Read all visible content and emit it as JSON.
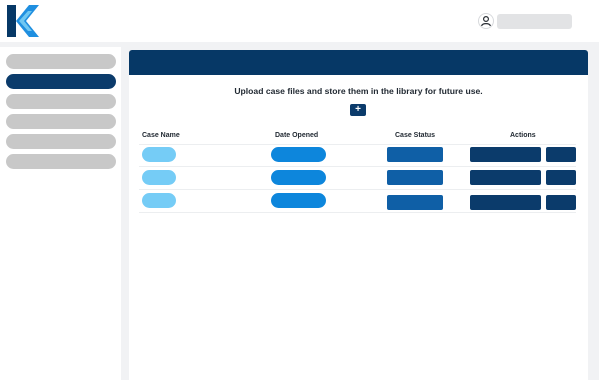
{
  "header": {
    "logo_icon": "kaseware-k-logo-icon",
    "user_icon": "user-icon",
    "user_name": ""
  },
  "sidebar": {
    "items": [
      {
        "label": "",
        "active": false
      },
      {
        "label": "",
        "active": true
      },
      {
        "label": "",
        "active": false
      },
      {
        "label": "",
        "active": false
      },
      {
        "label": "",
        "active": false
      },
      {
        "label": "",
        "active": false
      }
    ]
  },
  "main": {
    "instruction": "Upload case files and store them in the library for future use.",
    "add_button_label": "+",
    "table": {
      "columns": [
        "Case Name",
        "Date Opened",
        "Case Status",
        "Actions"
      ],
      "rows": [
        {
          "case_name": "",
          "date_opened": "",
          "case_status": "",
          "actions": [
            "",
            ""
          ]
        },
        {
          "case_name": "",
          "date_opened": "",
          "case_status": "",
          "actions": [
            "",
            ""
          ]
        },
        {
          "case_name": "",
          "date_opened": "",
          "case_status": "",
          "actions": [
            "",
            ""
          ]
        }
      ]
    }
  },
  "colors": {
    "primary_dark": "#063866",
    "accent_blue": "#0d86dc",
    "light_blue": "#75ccf6",
    "status_blue": "#0f5fa6",
    "placeholder_gray": "#c8c8c8"
  }
}
